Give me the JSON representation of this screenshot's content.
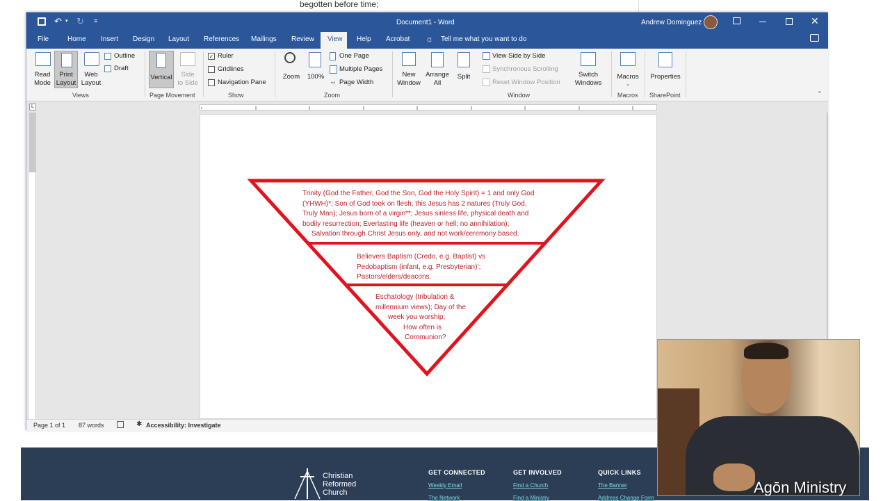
{
  "background_text": "begotten before time;",
  "title_bar": {
    "doc_title": "Document1 - Word",
    "user_name": "Andrew Dominguez"
  },
  "tabs": [
    "File",
    "Home",
    "Insert",
    "Design",
    "Layout",
    "References",
    "Mailings",
    "Review",
    "View",
    "Help",
    "Acrobat"
  ],
  "active_tab": "View",
  "tell_me": "Tell me what you want to do",
  "ribbon": {
    "views": {
      "read_mode_1": "Read",
      "read_mode_2": "Mode",
      "print_layout_1": "Print",
      "print_layout_2": "Layout",
      "web_layout_1": "Web",
      "web_layout_2": "Layout",
      "outline": "Outline",
      "draft": "Draft",
      "group": "Views"
    },
    "page_movement": {
      "vertical": "Vertical",
      "side_1": "Side",
      "side_2": "to Side",
      "group": "Page Movement"
    },
    "show": {
      "ruler": "Ruler",
      "gridlines": "Gridlines",
      "nav_pane": "Navigation Pane",
      "group": "Show"
    },
    "zoom": {
      "zoom": "Zoom",
      "hundred": "100%",
      "one_page": "One Page",
      "multiple_pages": "Multiple Pages",
      "page_width": "Page Width",
      "group": "Zoom"
    },
    "window": {
      "new_window_1": "New",
      "new_window_2": "Window",
      "arrange_1": "Arrange",
      "arrange_2": "All",
      "split": "Split",
      "side_by_side": "View Side by Side",
      "sync_scroll": "Synchronous Scrolling",
      "reset_pos": "Reset Window Position",
      "switch_1": "Switch",
      "switch_2": "Windows",
      "group": "Window"
    },
    "macros": {
      "macros": "Macros",
      "group": "Macros"
    },
    "sharepoint": {
      "properties": "Properties",
      "group": "SharePoint"
    }
  },
  "triangle": {
    "section1": [
      "Trinity (God the Father, God the Son, God the Holy Spirit) = 1 and only God",
      "(YHWH)*; Son of God took on flesh, this Jesus has 2 natures (Truly God,",
      "Truly Man); Jesus born of a virgin**; Jesus sinless life, physical death and",
      "bodily resurrection; Everlasting life (heaven or hell; no annihilation);",
      "Salvation through Christ Jesus only, and not work/ceremony based."
    ],
    "section2": [
      "Believers Baptism (Credo, e.g. Baptist) vs",
      "Pedobaptism (infant, e.g. Presbyterian)’;",
      "Pastors/elders/deacons."
    ],
    "section3": [
      "Eschatology (tribulation &",
      "millennium views); Day of the",
      "week you worship;",
      "How often is",
      "Communion?"
    ]
  },
  "status": {
    "page": "Page 1 of 1",
    "words": "87 words",
    "accessibility": "Accessibility: Investigate"
  },
  "footer": {
    "logo_1": "Christian",
    "logo_2": "Reformed",
    "logo_3": "Church",
    "col1_head": "GET CONNECTED",
    "col1_links": [
      "Weekly Email",
      "The Network"
    ],
    "col2_head": "GET INVOLVED",
    "col2_links": [
      "Find a Church",
      "Find a Ministry"
    ],
    "col3_head": "QUICK LINKS",
    "col3_links": [
      "The Banner",
      "Address Change Form"
    ]
  },
  "webcam_caption": "Agōn Ministry",
  "colors": {
    "word_blue": "#2b579a",
    "triangle_red": "#e0141e",
    "footer_bg": "#2c3e55"
  }
}
